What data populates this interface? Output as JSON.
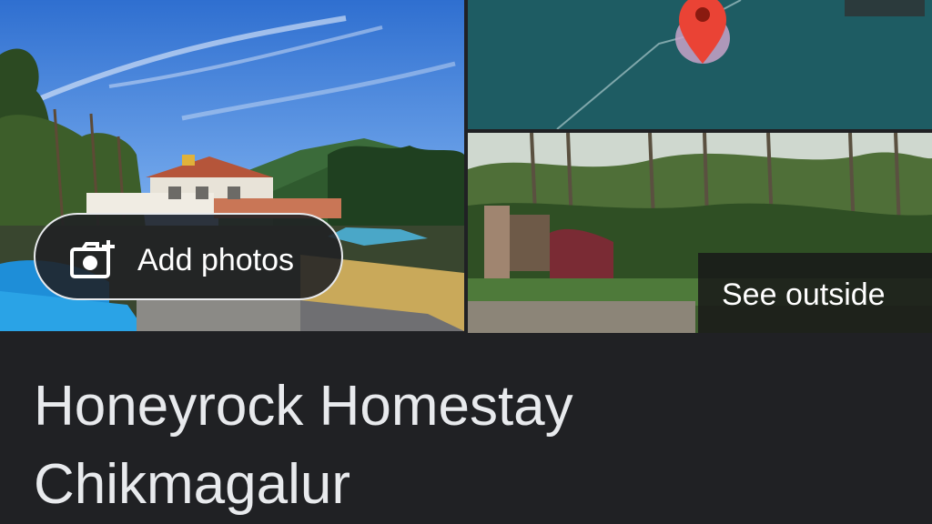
{
  "place": {
    "title": "Honeyrock Homestay Chikmagalur"
  },
  "photos": {
    "add_photos_label": "Add photos",
    "see_outside_label": "See outside",
    "add_photos_icon": "add-photo-camera-icon",
    "map_marker_icon": "map-pin-icon"
  },
  "colors": {
    "background": "#202124",
    "map_water": "#1e5c63",
    "marker_red": "#ea4335",
    "title_text": "#e8eaed"
  }
}
